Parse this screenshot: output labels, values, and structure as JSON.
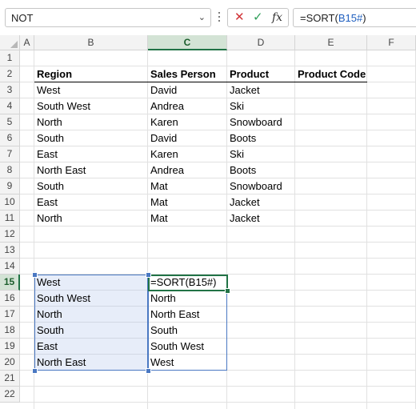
{
  "formula_bar": {
    "name_box": "NOT",
    "formula_prefix": "=SORT(",
    "formula_ref": "B15#",
    "formula_suffix": ")",
    "cancel_icon": "x-icon",
    "enter_icon": "check-icon",
    "function_icon": "fx"
  },
  "grid": {
    "columns": [
      "A",
      "B",
      "C",
      "D",
      "E",
      "F"
    ],
    "rows": [
      "1",
      "2",
      "3",
      "4",
      "5",
      "6",
      "7",
      "8",
      "9",
      "10",
      "11",
      "12",
      "13",
      "14",
      "15",
      "16",
      "17",
      "18",
      "19",
      "20",
      "21",
      "22"
    ]
  },
  "table": {
    "headers": [
      "Region",
      "Sales Person",
      "Product",
      "Product Code"
    ],
    "rows": [
      [
        "West",
        "David",
        "Jacket",
        ""
      ],
      [
        "South West",
        "Andrea",
        "Ski",
        ""
      ],
      [
        "North",
        "Karen",
        "Snowboard",
        ""
      ],
      [
        "South",
        "David",
        "Boots",
        ""
      ],
      [
        "East",
        "Karen",
        "Ski",
        ""
      ],
      [
        "North East",
        "Andrea",
        "Boots",
        ""
      ],
      [
        "South",
        "Mat",
        "Snowboard",
        ""
      ],
      [
        "East",
        "Mat",
        "Jacket",
        ""
      ],
      [
        "North",
        "Mat",
        "Jacket",
        ""
      ]
    ]
  },
  "spill_source": [
    "West",
    "South West",
    "North",
    "South",
    "East",
    "North East"
  ],
  "spill_result": [
    "=SORT(B15#)",
    "North",
    "North East",
    "South",
    "South West",
    "West"
  ],
  "colors": {
    "accent_green": "#217346",
    "range_blue": "#4a78c2",
    "x_red": "#d13438",
    "check_green": "#2e9e58"
  }
}
